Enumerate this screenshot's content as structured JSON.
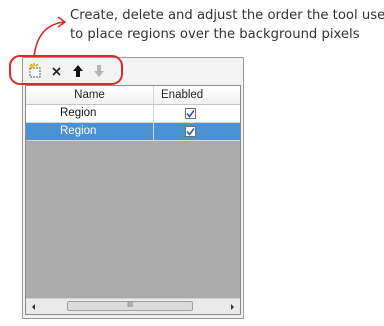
{
  "annotation": {
    "line1": "Create, delete and adjust the order the tool uses",
    "line2": "to place regions over the background pixels"
  },
  "toolbar": {
    "buttons": [
      {
        "icon": "new-region-icon",
        "enabled": true
      },
      {
        "icon": "delete-icon",
        "enabled": true
      },
      {
        "icon": "move-up-arrow-icon",
        "enabled": true
      },
      {
        "icon": "move-down-arrow-icon",
        "enabled": false
      }
    ]
  },
  "grid": {
    "columns": {
      "name": "Name",
      "enabled": "Enabled"
    },
    "rows": [
      {
        "name": "Region",
        "enabled": true,
        "selected": false
      },
      {
        "name": "Region",
        "enabled": true,
        "selected": true
      }
    ]
  },
  "scrollbar": {
    "grip": "III"
  },
  "colors": {
    "highlight_outline": "#d62c2c",
    "selected_row": "#4b92d4",
    "grid_background": "#ababab"
  }
}
